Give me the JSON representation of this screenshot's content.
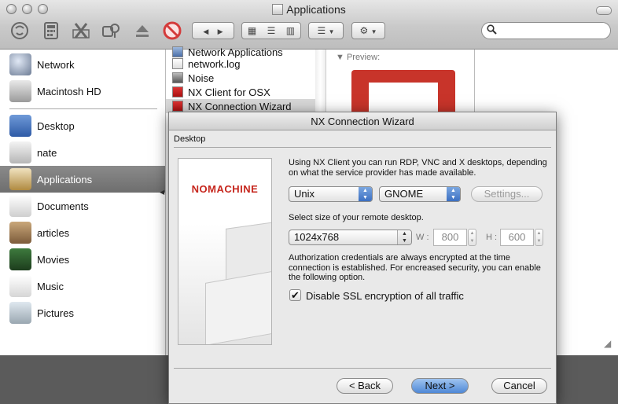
{
  "finder": {
    "title": "Applications",
    "search": {
      "placeholder": ""
    },
    "toolbar": {
      "back": "◀",
      "forward": "▶",
      "view_icons": "▦",
      "view_list": "☰",
      "view_columns": "▥",
      "arrange": "☰",
      "action": "⚙"
    },
    "sidebar": {
      "items": [
        {
          "label": "Network",
          "icon": "globe-icon"
        },
        {
          "label": "Macintosh HD",
          "icon": "hard-drive-icon"
        },
        {
          "label": "Desktop",
          "icon": "desktop-icon"
        },
        {
          "label": "nate",
          "icon": "home-icon"
        },
        {
          "label": "Applications",
          "icon": "applications-icon",
          "selected": true
        },
        {
          "label": "Documents",
          "icon": "documents-icon"
        },
        {
          "label": "articles",
          "icon": "folder-icon"
        },
        {
          "label": "Movies",
          "icon": "movies-icon"
        },
        {
          "label": "Music",
          "icon": "music-icon"
        },
        {
          "label": "Pictures",
          "icon": "pictures-icon"
        }
      ]
    },
    "column": {
      "items": [
        {
          "label": "Network Applications"
        },
        {
          "label": "network.log"
        },
        {
          "label": "Noise"
        },
        {
          "label": "NX Client for OSX"
        },
        {
          "label": "NX Connection Wizard",
          "selected": true
        }
      ]
    },
    "preview_label": "▼ Preview:"
  },
  "dialog": {
    "title": "NX Connection Wizard",
    "section": "Desktop",
    "banner_logo": "NOMACHINE",
    "intro_lines": [
      "Using NX Client you can run RDP, VNC and X desktops, depending",
      "on what the service provider has made available."
    ],
    "os_select": "Unix",
    "desktop_select": "GNOME",
    "settings_button": "Settings...",
    "size_prompt": "Select size of your remote desktop.",
    "size_select": "1024x768",
    "width_label": "W :",
    "width_value": "800",
    "height_label": "H :",
    "height_value": "600",
    "auth_lines": [
      "Authorization credentials are always encrypted at the time",
      "connection is established. For encreased security, you can enable",
      "the following option."
    ],
    "ssl_label": "Disable SSL encryption of all traffic",
    "ssl_checked": "✔",
    "back_button": "< Back",
    "next_button": "Next >",
    "cancel_button": "Cancel"
  },
  "colors": {
    "accent_blue": "#4f88d6",
    "nomachine_red": "#c6261d",
    "sidebar_selected": "#7a7a7a"
  }
}
